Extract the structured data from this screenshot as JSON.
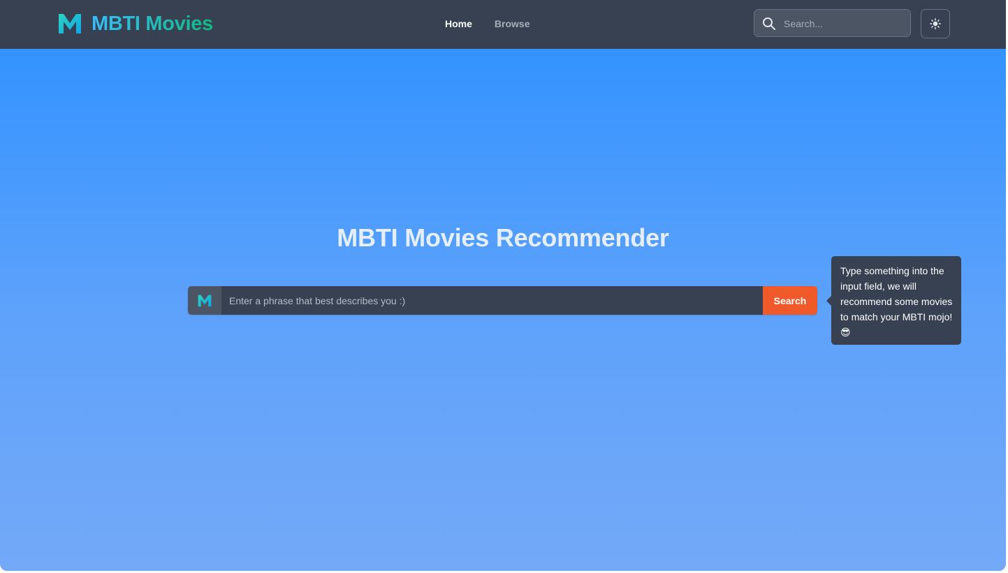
{
  "brand": {
    "name": "MBTI Movies",
    "logo_letter": "M"
  },
  "nav": {
    "items": [
      {
        "label": "Home",
        "active": true
      },
      {
        "label": "Browse",
        "active": false
      }
    ]
  },
  "top_search": {
    "placeholder": "Search..."
  },
  "theme_toggle": {
    "icon": "sun-icon"
  },
  "hero": {
    "title": "MBTI Movies Recommender",
    "input_placeholder": "Enter a phrase that best describes you :)",
    "input_value": "",
    "search_label": "Search"
  },
  "tooltip": {
    "text": "Type something into the input field, we will recommend some movies to match your MBTI mojo! 😎"
  },
  "colors": {
    "navbar": "#374151",
    "accent": "#f05a2b",
    "gradient_top": "#2c90ff",
    "gradient_bottom": "#74a9f8",
    "brand_gradient_start": "#38bdf8",
    "brand_gradient_end": "#10b981"
  }
}
